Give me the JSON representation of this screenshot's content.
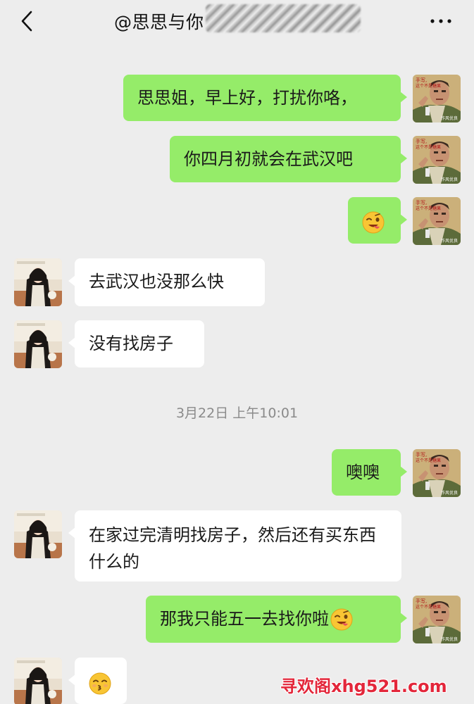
{
  "header": {
    "title": "@思思与你",
    "back_icon": "chevron-left-icon",
    "more_icon": "more-dots-icon"
  },
  "messages": [
    {
      "sender": "me",
      "text": "思思姐，早上好，打扰你咯，"
    },
    {
      "sender": "me",
      "text": "你四月初就会在武汉吧"
    },
    {
      "sender": "me",
      "text": "",
      "emoji": "wink-tongue-emoji"
    },
    {
      "sender": "her",
      "text": "去武汉也没那么快"
    },
    {
      "sender": "her",
      "text": "没有找房子"
    },
    {
      "sender": "me",
      "text": "噢噢"
    },
    {
      "sender": "her",
      "text": "在家过完清明找房子，然后还有买东西什么的"
    },
    {
      "sender": "me",
      "text": "那我只能五一去找你啦",
      "emoji": "wink-tongue-emoji"
    },
    {
      "sender": "her",
      "text": "",
      "emoji": "kissing-emoji"
    }
  ],
  "timestamp": "3月22日 上午10:01",
  "avatar_me_caption": "手写，\n这个不是糖果",
  "avatar_me_sub": "作风优良",
  "watermark": "寻欢阁xhg521.com",
  "colors": {
    "background": "#ededed",
    "my_bubble": "#95ec69",
    "her_bubble": "#ffffff",
    "watermark": "#e3263a"
  }
}
